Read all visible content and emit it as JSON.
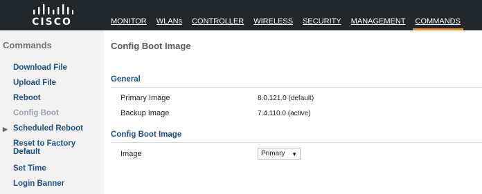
{
  "brand": {
    "name": "CISCO"
  },
  "nav": {
    "items": [
      {
        "label": "MONITOR"
      },
      {
        "label": "WLANs"
      },
      {
        "label": "CONTROLLER"
      },
      {
        "label": "WIRELESS"
      },
      {
        "label": "SECURITY"
      },
      {
        "label": "MANAGEMENT"
      },
      {
        "label": "COMMANDS"
      }
    ],
    "active": "COMMANDS",
    "accent": "#f08a1c"
  },
  "sidebar": {
    "title": "Commands",
    "items": [
      {
        "label": "Download File"
      },
      {
        "label": "Upload File"
      },
      {
        "label": "Reboot"
      },
      {
        "label": "Config Boot"
      },
      {
        "label": "Scheduled Reboot"
      },
      {
        "label": "Reset to Factory Default"
      },
      {
        "label": "Set Time"
      },
      {
        "label": "Login Banner"
      }
    ]
  },
  "main": {
    "title": "Config Boot Image",
    "general": {
      "title": "General",
      "primary_label": "Primary Image",
      "primary_value": "8.0.121.0 (default)",
      "backup_label": "Backup Image",
      "backup_value": "7.4.110.0 (active)"
    },
    "config": {
      "title": "Config Boot Image",
      "image_label": "Image",
      "image_value": "Primary"
    }
  }
}
